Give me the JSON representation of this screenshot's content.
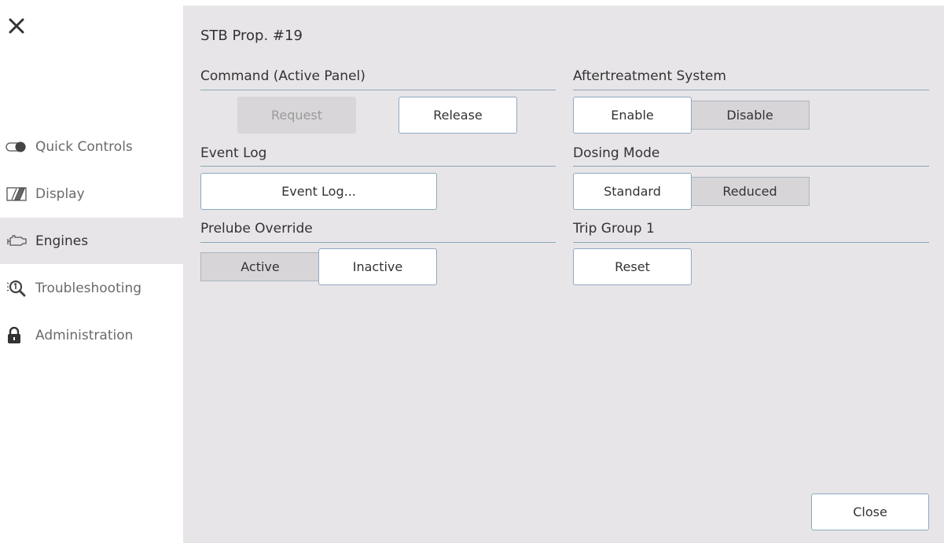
{
  "sidebar": {
    "items": [
      {
        "label": "Quick Controls",
        "icon": "toggle-icon"
      },
      {
        "label": "Display",
        "icon": "display-icon"
      },
      {
        "label": "Engines",
        "icon": "engine-icon"
      },
      {
        "label": "Troubleshooting",
        "icon": "troubleshooting-icon"
      },
      {
        "label": "Administration",
        "icon": "lock-icon"
      }
    ],
    "active": "Engines"
  },
  "main": {
    "title": "STB Prop. #19",
    "command": {
      "label": "Command (Active Panel)",
      "request": "Request",
      "release": "Release"
    },
    "event_log": {
      "label": "Event Log",
      "button": "Event Log..."
    },
    "prelube": {
      "label": "Prelube Override",
      "active": "Active",
      "inactive": "Inactive",
      "selected": "Inactive"
    },
    "aftertreatment": {
      "label": "Aftertreatment System",
      "enable": "Enable",
      "disable": "Disable",
      "selected": "Enable"
    },
    "dosing": {
      "label": "Dosing Mode",
      "standard": "Standard",
      "reduced": "Reduced",
      "selected": "Standard"
    },
    "trip_group": {
      "label": "Trip Group 1",
      "reset": "Reset"
    },
    "close_label": "Close"
  },
  "colors": {
    "panel_bg": "#e8e5e8",
    "rule": "#8aa6b8",
    "button_border": "#8ea9c0"
  }
}
